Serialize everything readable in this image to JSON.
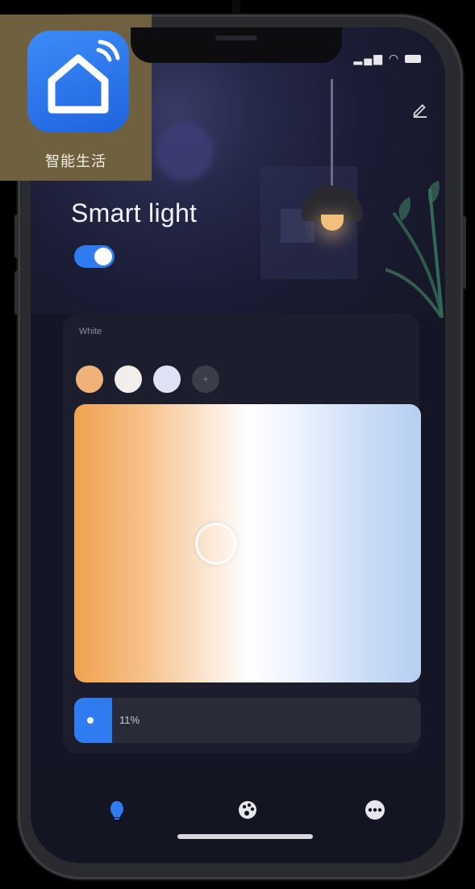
{
  "device": {
    "app_icon_name": "智能生活"
  },
  "status_bar": {
    "icons": [
      "cellular-icon",
      "wifi-icon",
      "battery-icon"
    ]
  },
  "header": {
    "title": "Smart light",
    "power_on": true
  },
  "white_panel": {
    "label": "White",
    "swatches": [
      {
        "name": "warm",
        "color": "#f1b27a"
      },
      {
        "name": "neutral",
        "color": "#f2eeea"
      },
      {
        "name": "cool",
        "color": "#dfe3f6"
      }
    ],
    "brightness_percent": 11,
    "brightness_label": "11%"
  },
  "colors": {
    "accent": "#2f7cf0",
    "background": "#151625"
  },
  "tab_bar": {
    "tabs": [
      "white-light-icon",
      "color-palette-icon",
      "more-icon"
    ]
  }
}
